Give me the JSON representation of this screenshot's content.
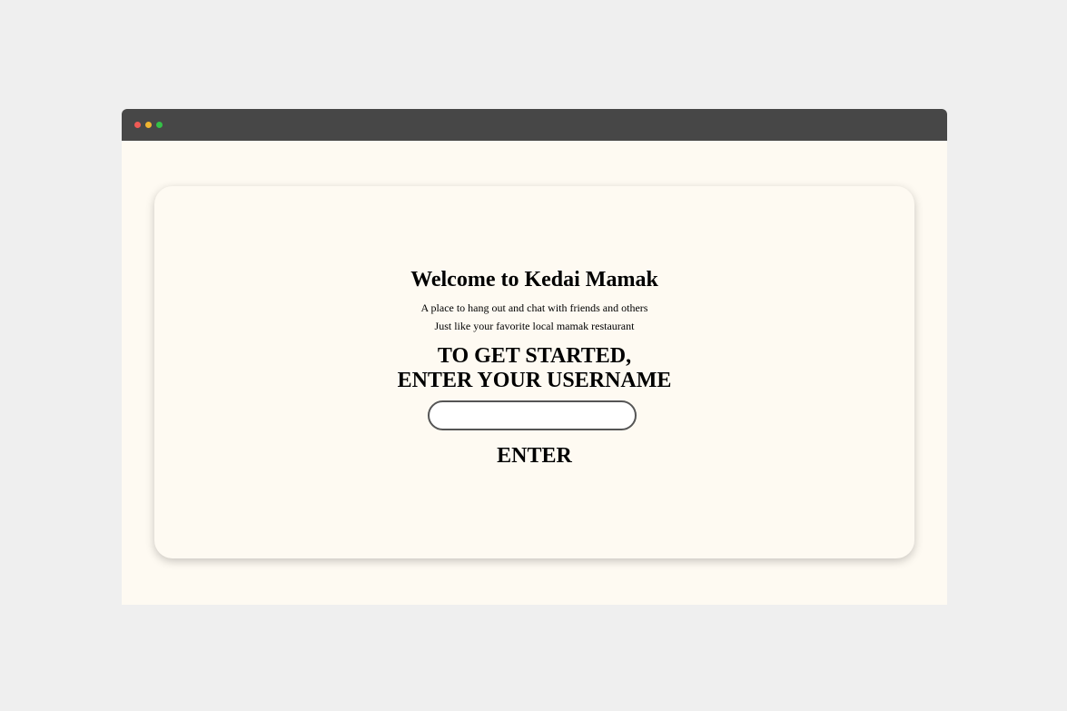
{
  "window": {
    "controls": [
      "close-dot",
      "minimize-dot",
      "maximize-dot"
    ]
  },
  "colors": {
    "page_background": "#efefef",
    "titlebar": "#474747",
    "content_background": "#fefaf2",
    "close": "#ef5a55",
    "minimize": "#efb430",
    "maximize": "#34c147"
  },
  "card": {
    "title": "Welcome to Kedai Mamak",
    "subtitle_line1": "A place to hang out and chat with friends and others",
    "subtitle_line2": "Just like your favorite local mamak restaurant",
    "prompt_line1": "TO GET STARTED,",
    "prompt_line2": "ENTER YOUR USERNAME",
    "username_value": "",
    "username_placeholder": "",
    "enter_label": "ENTER"
  }
}
